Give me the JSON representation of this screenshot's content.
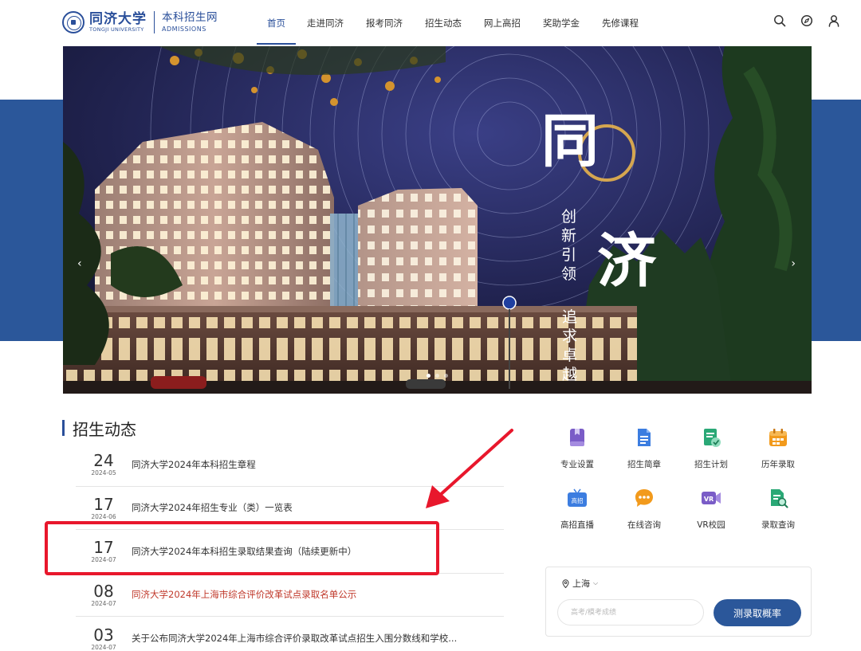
{
  "logo": {
    "cn": "同济大学",
    "en": "TONGJI UNIVERSITY",
    "sub_cn": "本科招生网",
    "sub_en": "ADMISSIONS"
  },
  "nav": [
    {
      "label": "首页",
      "active": true
    },
    {
      "label": "走进同济"
    },
    {
      "label": "报考同济"
    },
    {
      "label": "招生动态"
    },
    {
      "label": "网上高招"
    },
    {
      "label": "奖助学金"
    },
    {
      "label": "先修课程"
    }
  ],
  "header_icons": [
    "search-icon",
    "compass-icon",
    "user-icon"
  ],
  "banner": {
    "title_1": "同",
    "title_2": "济",
    "slogan_1": "创新引领",
    "slogan_2": "追求卓越",
    "prev_arrow": "‹",
    "next_arrow": "›",
    "slide_count": 3,
    "active_slide": 0
  },
  "news": {
    "title": "招生动态",
    "items": [
      {
        "day": "24",
        "ym": "2024-05",
        "title": "同济大学2024年本科招生章程",
        "red": false
      },
      {
        "day": "17",
        "ym": "2024-06",
        "title": "同济大学2024年招生专业（类）一览表",
        "red": false
      },
      {
        "day": "17",
        "ym": "2024-07",
        "title": "同济大学2024年本科招生录取结果查询（陆续更新中）",
        "red": false
      },
      {
        "day": "08",
        "ym": "2024-07",
        "title": "同济大学2024年上海市综合评价改革试点录取名单公示",
        "red": true
      },
      {
        "day": "03",
        "ym": "2024-07",
        "title": "关于公布同济大学2024年上海市综合评价录取改革试点招生入围分数线和学校...",
        "red": false
      }
    ]
  },
  "quick_links": [
    {
      "label": "专业设置",
      "icon": "book-icon",
      "color": "#7a5cc7"
    },
    {
      "label": "招生简章",
      "icon": "document-icon",
      "color": "#3c7de0"
    },
    {
      "label": "招生计划",
      "icon": "plan-check-icon",
      "color": "#2aa876"
    },
    {
      "label": "历年录取",
      "icon": "calendar-icon",
      "color": "#f29a1c"
    },
    {
      "label": "高招直播",
      "icon": "tv-live-icon",
      "color": "#3c7de0",
      "badge": "高招"
    },
    {
      "label": "在线咨询",
      "icon": "chat-bubble-icon",
      "color": "#f29a1c"
    },
    {
      "label": "VR校园",
      "icon": "vr-camera-icon",
      "color": "#7a5cc7",
      "badge": "VR"
    },
    {
      "label": "录取查询",
      "icon": "search-document-icon",
      "color": "#2aa876"
    }
  ],
  "predictor": {
    "region": "上海",
    "input_placeholder": "高考/模考成绩",
    "input_value": "",
    "button_label": "测录取概率"
  },
  "colors": {
    "brand_blue": "#2a4f9a",
    "band_blue": "#2b579a",
    "highlight_red": "#e8172c",
    "news_red": "#c0392b"
  }
}
